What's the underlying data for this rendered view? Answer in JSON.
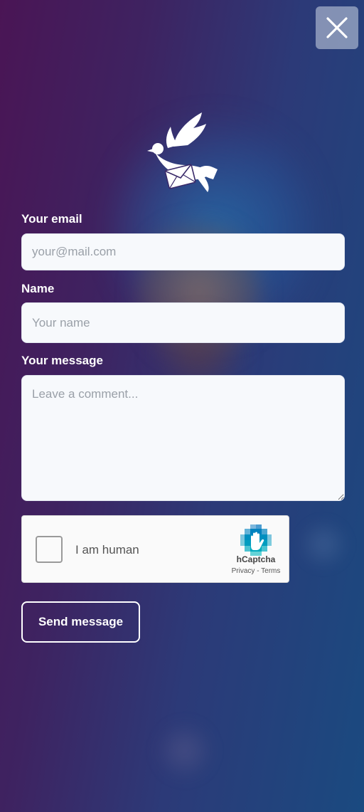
{
  "close": {
    "icon": "close-icon"
  },
  "logo": {
    "icon": "dove-envelope-icon"
  },
  "form": {
    "email": {
      "label": "Your email",
      "placeholder": "your@mail.com",
      "value": ""
    },
    "name": {
      "label": "Name",
      "placeholder": "Your name",
      "value": ""
    },
    "message": {
      "label": "Your message",
      "placeholder": "Leave a comment...",
      "value": ""
    }
  },
  "captcha": {
    "label": "I am human",
    "brand": "hCaptcha",
    "privacy": "Privacy",
    "separator": " - ",
    "terms": "Terms",
    "checked": false
  },
  "send_label": "Send message",
  "colors": {
    "background_start": "#4a1555",
    "background_end": "#1a4a80",
    "field_background": "#f7f9fc"
  }
}
